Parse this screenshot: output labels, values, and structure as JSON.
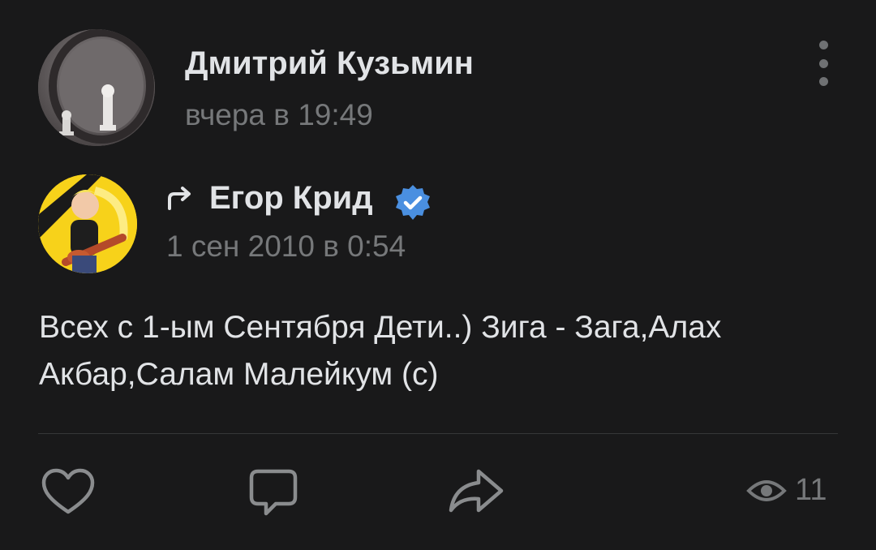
{
  "post": {
    "author": {
      "name": "Дмитрий Кузьмин",
      "time": "вчера в 19:49",
      "avatar_icon": "chess-pieces-avatar"
    },
    "repost": {
      "name": "Егор Крид",
      "time": "1 сен 2010 в 0:54",
      "verified": true,
      "avatar_icon": "cartoon-guitarist-avatar"
    },
    "text": "Всех с 1-ым Сентября Дети..) Зига - Зага,Алах Акбар,Салам Малейкум (с)",
    "actions": {
      "like_icon": "heart-icon",
      "comment_icon": "comment-icon",
      "share_icon": "share-icon"
    },
    "views": {
      "icon": "eye-icon",
      "count": "11"
    }
  },
  "colors": {
    "background": "#19191a",
    "text_primary": "#e1e3e6",
    "text_secondary": "#76787a",
    "verified": "#4a8fe0",
    "divider": "#363738"
  }
}
